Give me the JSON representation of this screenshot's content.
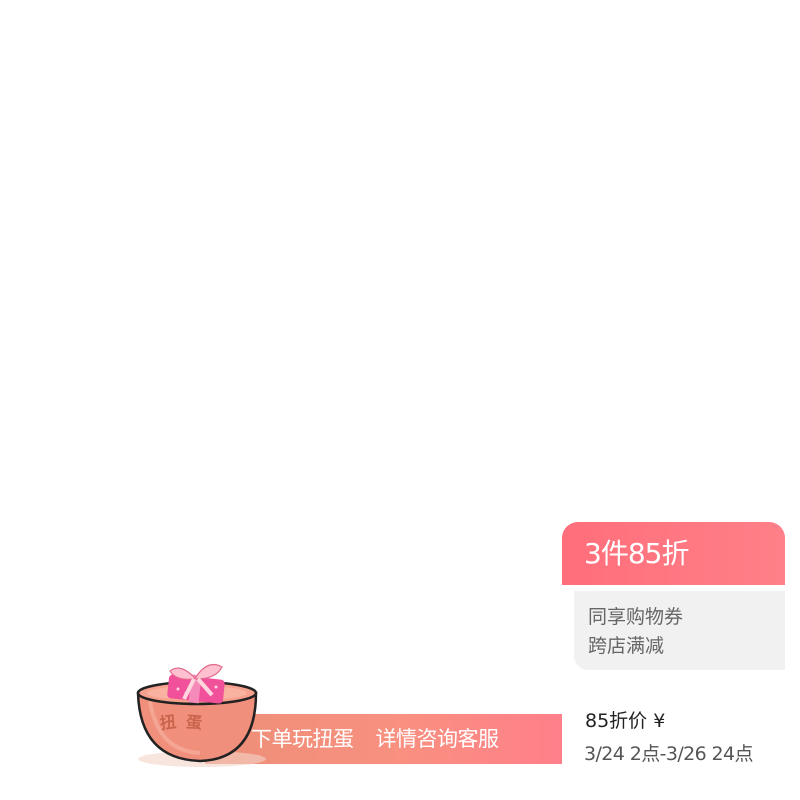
{
  "promo": {
    "headline": "3件85折",
    "line1": "同享购物券",
    "line2": "跨店满减",
    "price_label": "85折价 ¥",
    "date_range": "3/24 2点-3/26 24点"
  },
  "banner": {
    "text_left": "下单玩扭蛋",
    "text_right": "详情咨询客服",
    "capsule_label_1": "扭",
    "capsule_label_2": "蛋"
  },
  "colors": {
    "accent": "#ff6e7b",
    "banner_start": "#ec8f78",
    "banner_end": "#ff7f8a",
    "panel_bg": "#f1f1f1"
  },
  "icons": {
    "capsule": "gacha-capsule-icon",
    "gift": "gift-box-icon"
  }
}
